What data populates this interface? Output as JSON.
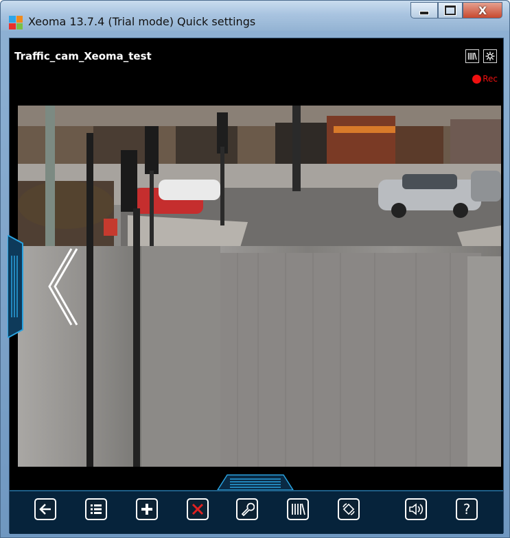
{
  "window": {
    "title": "Xeoma 13.7.4 (Trial mode) Quick settings",
    "controls": {
      "minimize": "minimize",
      "maximize": "maximize",
      "close": "X"
    }
  },
  "camera": {
    "name": "Traffic_cam_Xeoma_test",
    "recording_label": "Rec",
    "recording_color": "#f01010",
    "top_icons": [
      "archive-icon",
      "settings-gear-icon"
    ]
  },
  "toolbar": {
    "buttons": [
      {
        "name": "back-arrow-icon",
        "label": "Back"
      },
      {
        "name": "list-icon",
        "label": "List"
      },
      {
        "name": "add-plus-icon",
        "label": "Add"
      },
      {
        "name": "delete-x-icon",
        "label": "Delete",
        "color": "#e02020"
      },
      {
        "name": "wrench-icon",
        "label": "Settings"
      },
      {
        "name": "archive-icon",
        "label": "Archive"
      },
      {
        "name": "ptz-rotate-icon",
        "label": "PTZ"
      },
      {
        "name": "speaker-icon",
        "label": "Sound"
      },
      {
        "name": "help-icon",
        "label": "?"
      }
    ]
  },
  "colors": {
    "accent": "#1e5e86",
    "handle": "#2aa3e0",
    "titlebar": "#a9c4e0"
  }
}
